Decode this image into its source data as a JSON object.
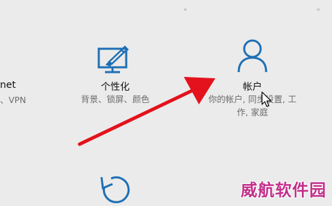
{
  "tiles": {
    "network": {
      "title": "net",
      "desc": "、VPN"
    },
    "personalization": {
      "title": "个性化",
      "desc": "背景、锁屏、颜色"
    },
    "accounts": {
      "title": "帐户",
      "desc_line1": "你的帐户, 同步设置, 工",
      "desc_line2": "作, 家庭"
    }
  },
  "watermark": "威航软件园",
  "colors": {
    "accent": "#1e6fb5",
    "arrow": "#e3121c",
    "background": "#ebebeb"
  },
  "icons": {
    "personalization": "paint-monitor-icon",
    "accounts": "person-icon",
    "update": "refresh-icon"
  }
}
